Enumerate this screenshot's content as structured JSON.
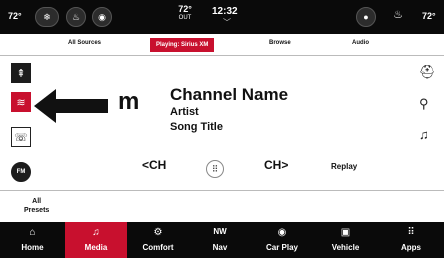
{
  "status_bar": {
    "left_temp": "72°",
    "center_temp": "72°",
    "outside_label": "OUT",
    "time": "12:32",
    "right_temp": "72°"
  },
  "tabs": [
    {
      "label": "All Sources",
      "active": false
    },
    {
      "label": "Playing: Sirius XM",
      "active": true
    },
    {
      "label": "Browse",
      "active": false
    },
    {
      "label": "Audio",
      "active": false
    }
  ],
  "now_playing": {
    "logo_letter": "m",
    "channel_name": "Channel Name",
    "artist": "Artist",
    "song_title": "Song Title"
  },
  "left_buttons": [
    {
      "icon": "usb-icon"
    },
    {
      "icon": "siriusxm-icon"
    },
    {
      "icon": "phone-audio-icon"
    },
    {
      "icon": "fm-radio-icon",
      "label": "FM"
    }
  ],
  "right_buttons": [
    {
      "icon": "favorite-icon"
    },
    {
      "icon": "search-icon"
    },
    {
      "icon": "alert-bell-icon"
    }
  ],
  "controls": {
    "ch_prev": "CH",
    "ch_next": "CH",
    "replay": "Replay"
  },
  "presets": {
    "line1": "All",
    "line2": "Presets"
  },
  "bottom_nav": [
    {
      "label": "Home",
      "icon": "home-icon",
      "active": false
    },
    {
      "label": "Media",
      "icon": "music-note-icon",
      "active": true
    },
    {
      "label": "Comfort",
      "icon": "comfort-icon",
      "active": false
    },
    {
      "label": "Nav",
      "icon": "compass-icon",
      "active": false,
      "compass": "NW"
    },
    {
      "label": "Car Play",
      "icon": "carplay-icon",
      "active": false
    },
    {
      "label": "Vehicle",
      "icon": "vehicle-icon",
      "active": false
    },
    {
      "label": "Apps",
      "icon": "apps-grid-icon",
      "active": false
    }
  ],
  "colors": {
    "accent": "#c8102e",
    "bar_background": "#0a0a0a"
  }
}
